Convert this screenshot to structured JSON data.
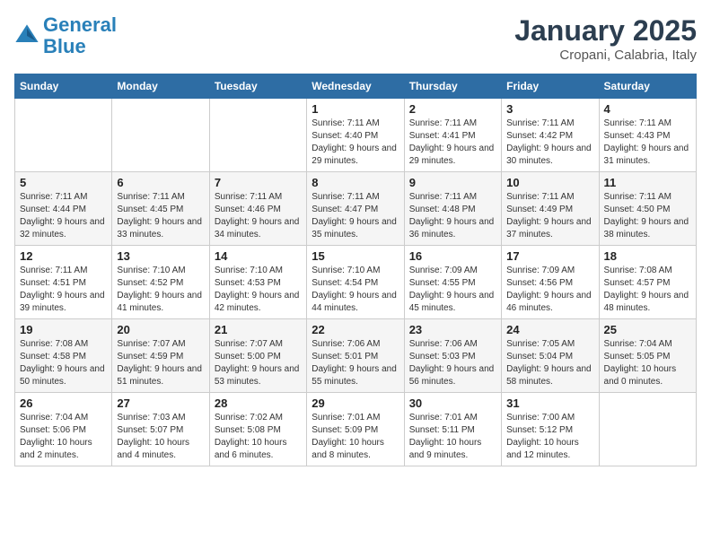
{
  "logo": {
    "line1": "General",
    "line2": "Blue"
  },
  "title": "January 2025",
  "subtitle": "Cropani, Calabria, Italy",
  "days_header": [
    "Sunday",
    "Monday",
    "Tuesday",
    "Wednesday",
    "Thursday",
    "Friday",
    "Saturday"
  ],
  "weeks": [
    [
      {
        "num": "",
        "info": ""
      },
      {
        "num": "",
        "info": ""
      },
      {
        "num": "",
        "info": ""
      },
      {
        "num": "1",
        "info": "Sunrise: 7:11 AM\nSunset: 4:40 PM\nDaylight: 9 hours and 29 minutes."
      },
      {
        "num": "2",
        "info": "Sunrise: 7:11 AM\nSunset: 4:41 PM\nDaylight: 9 hours and 29 minutes."
      },
      {
        "num": "3",
        "info": "Sunrise: 7:11 AM\nSunset: 4:42 PM\nDaylight: 9 hours and 30 minutes."
      },
      {
        "num": "4",
        "info": "Sunrise: 7:11 AM\nSunset: 4:43 PM\nDaylight: 9 hours and 31 minutes."
      }
    ],
    [
      {
        "num": "5",
        "info": "Sunrise: 7:11 AM\nSunset: 4:44 PM\nDaylight: 9 hours and 32 minutes."
      },
      {
        "num": "6",
        "info": "Sunrise: 7:11 AM\nSunset: 4:45 PM\nDaylight: 9 hours and 33 minutes."
      },
      {
        "num": "7",
        "info": "Sunrise: 7:11 AM\nSunset: 4:46 PM\nDaylight: 9 hours and 34 minutes."
      },
      {
        "num": "8",
        "info": "Sunrise: 7:11 AM\nSunset: 4:47 PM\nDaylight: 9 hours and 35 minutes."
      },
      {
        "num": "9",
        "info": "Sunrise: 7:11 AM\nSunset: 4:48 PM\nDaylight: 9 hours and 36 minutes."
      },
      {
        "num": "10",
        "info": "Sunrise: 7:11 AM\nSunset: 4:49 PM\nDaylight: 9 hours and 37 minutes."
      },
      {
        "num": "11",
        "info": "Sunrise: 7:11 AM\nSunset: 4:50 PM\nDaylight: 9 hours and 38 minutes."
      }
    ],
    [
      {
        "num": "12",
        "info": "Sunrise: 7:11 AM\nSunset: 4:51 PM\nDaylight: 9 hours and 39 minutes."
      },
      {
        "num": "13",
        "info": "Sunrise: 7:10 AM\nSunset: 4:52 PM\nDaylight: 9 hours and 41 minutes."
      },
      {
        "num": "14",
        "info": "Sunrise: 7:10 AM\nSunset: 4:53 PM\nDaylight: 9 hours and 42 minutes."
      },
      {
        "num": "15",
        "info": "Sunrise: 7:10 AM\nSunset: 4:54 PM\nDaylight: 9 hours and 44 minutes."
      },
      {
        "num": "16",
        "info": "Sunrise: 7:09 AM\nSunset: 4:55 PM\nDaylight: 9 hours and 45 minutes."
      },
      {
        "num": "17",
        "info": "Sunrise: 7:09 AM\nSunset: 4:56 PM\nDaylight: 9 hours and 46 minutes."
      },
      {
        "num": "18",
        "info": "Sunrise: 7:08 AM\nSunset: 4:57 PM\nDaylight: 9 hours and 48 minutes."
      }
    ],
    [
      {
        "num": "19",
        "info": "Sunrise: 7:08 AM\nSunset: 4:58 PM\nDaylight: 9 hours and 50 minutes."
      },
      {
        "num": "20",
        "info": "Sunrise: 7:07 AM\nSunset: 4:59 PM\nDaylight: 9 hours and 51 minutes."
      },
      {
        "num": "21",
        "info": "Sunrise: 7:07 AM\nSunset: 5:00 PM\nDaylight: 9 hours and 53 minutes."
      },
      {
        "num": "22",
        "info": "Sunrise: 7:06 AM\nSunset: 5:01 PM\nDaylight: 9 hours and 55 minutes."
      },
      {
        "num": "23",
        "info": "Sunrise: 7:06 AM\nSunset: 5:03 PM\nDaylight: 9 hours and 56 minutes."
      },
      {
        "num": "24",
        "info": "Sunrise: 7:05 AM\nSunset: 5:04 PM\nDaylight: 9 hours and 58 minutes."
      },
      {
        "num": "25",
        "info": "Sunrise: 7:04 AM\nSunset: 5:05 PM\nDaylight: 10 hours and 0 minutes."
      }
    ],
    [
      {
        "num": "26",
        "info": "Sunrise: 7:04 AM\nSunset: 5:06 PM\nDaylight: 10 hours and 2 minutes."
      },
      {
        "num": "27",
        "info": "Sunrise: 7:03 AM\nSunset: 5:07 PM\nDaylight: 10 hours and 4 minutes."
      },
      {
        "num": "28",
        "info": "Sunrise: 7:02 AM\nSunset: 5:08 PM\nDaylight: 10 hours and 6 minutes."
      },
      {
        "num": "29",
        "info": "Sunrise: 7:01 AM\nSunset: 5:09 PM\nDaylight: 10 hours and 8 minutes."
      },
      {
        "num": "30",
        "info": "Sunrise: 7:01 AM\nSunset: 5:11 PM\nDaylight: 10 hours and 9 minutes."
      },
      {
        "num": "31",
        "info": "Sunrise: 7:00 AM\nSunset: 5:12 PM\nDaylight: 10 hours and 12 minutes."
      },
      {
        "num": "",
        "info": ""
      }
    ]
  ]
}
